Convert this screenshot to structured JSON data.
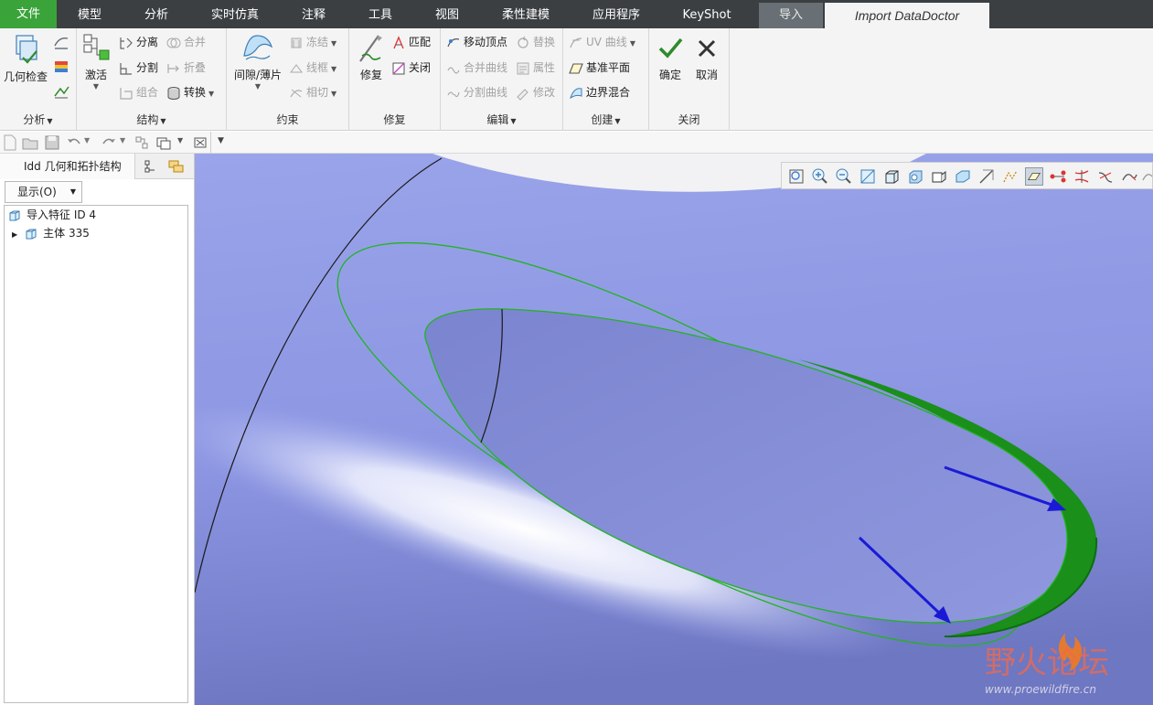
{
  "menu_tabs": {
    "file": "文件",
    "model": "模型",
    "analysis": "分析",
    "simulation": "实时仿真",
    "annotate": "注释",
    "tools": "工具",
    "view": "视图",
    "flexible": "柔性建模",
    "apps": "应用程序",
    "keyshot": "KeyShot",
    "import": "导入",
    "active": "Import DataDoctor"
  },
  "ribbon": {
    "analysis": {
      "label": "分析",
      "geometry_check": "几何检查"
    },
    "structure": {
      "label": "结构",
      "activate": "激活",
      "separate": "分离",
      "split": "分割",
      "group": "组合",
      "merge": "合并",
      "fold": "折叠",
      "convert": "转换"
    },
    "constraint": {
      "label": "约束",
      "gap_sheet": "间隙/薄片",
      "freeze": "冻结",
      "wireframe": "线框",
      "tangent": "相切"
    },
    "repair": {
      "label": "修复",
      "repair": "修复",
      "match": "匹配",
      "close": "关闭"
    },
    "edit": {
      "label": "编辑",
      "move_vertex": "移动顶点",
      "merge_curve": "合并曲线",
      "split_curve": "分割曲线",
      "replace": "替换",
      "properties": "属性",
      "modify": "修改"
    },
    "create": {
      "label": "创建",
      "uv_curve": "UV 曲线",
      "datum_plane": "基准平面",
      "boundary_blend": "边界混合"
    },
    "close_group": {
      "label": "关闭",
      "ok": "确定",
      "cancel": "取消"
    }
  },
  "panel": {
    "tab_label": "Idd 几何和拓扑结构",
    "show_button": "显示(O)",
    "tree": [
      {
        "label": "导入特征 ID 4"
      },
      {
        "label": "主体 335"
      }
    ]
  },
  "watermark": {
    "cn": "野火论坛",
    "url": "www.proewildfire.cn"
  },
  "colors": {
    "file_tab": "#3aa33a",
    "tab_bar": "#3b3f42",
    "surface_blue": "#8e99e3",
    "highlight_green": "#22b322",
    "arrow_blue": "#1a1ad6"
  }
}
